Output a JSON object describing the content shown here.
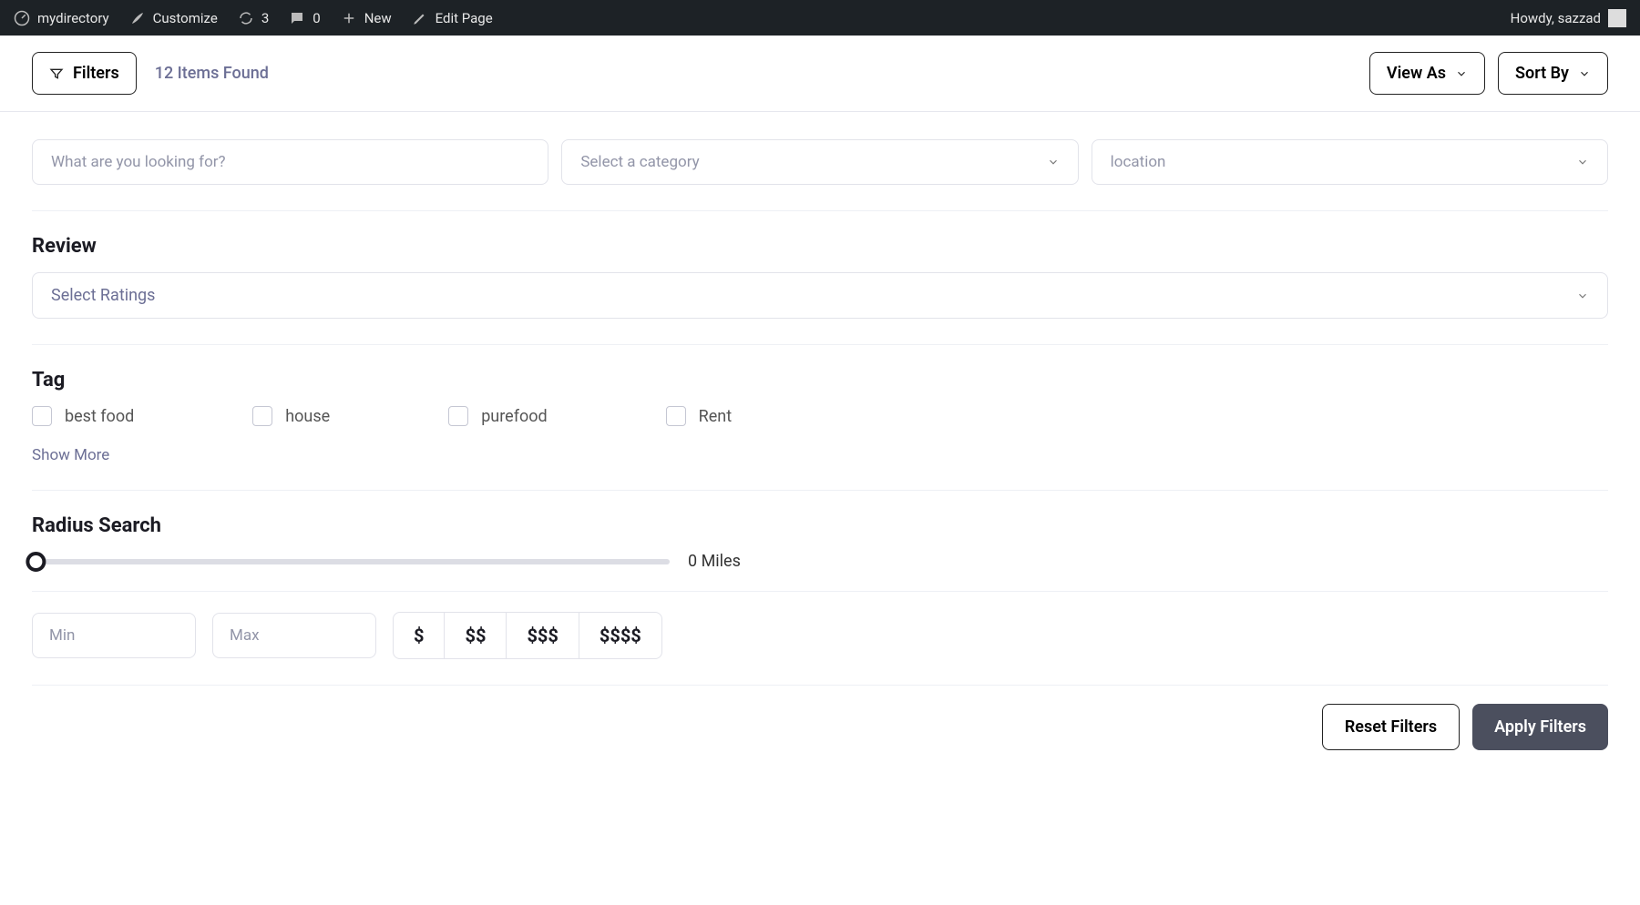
{
  "admin": {
    "site": "mydirectory",
    "customize": "Customize",
    "updates": "3",
    "comments": "0",
    "new": "New",
    "edit": "Edit Page",
    "greeting": "Howdy, sazzad"
  },
  "toolbar": {
    "filters": "Filters",
    "items_found": "12 Items Found",
    "view_as": "View As",
    "sort_by": "Sort By"
  },
  "search": {
    "query_placeholder": "What are you looking for?",
    "category_placeholder": "Select a category",
    "location_placeholder": "location"
  },
  "review": {
    "title": "Review",
    "select_placeholder": "Select Ratings"
  },
  "tag": {
    "title": "Tag",
    "items": [
      "best food",
      "house",
      "purefood",
      "Rent"
    ],
    "show_more": "Show More"
  },
  "radius": {
    "title": "Radius Search",
    "value_label": "0 Miles"
  },
  "price": {
    "min_placeholder": "Min",
    "max_placeholder": "Max",
    "levels": [
      "$",
      "$$",
      "$$$",
      "$$$$"
    ]
  },
  "actions": {
    "reset": "Reset Filters",
    "apply": "Apply Filters"
  }
}
